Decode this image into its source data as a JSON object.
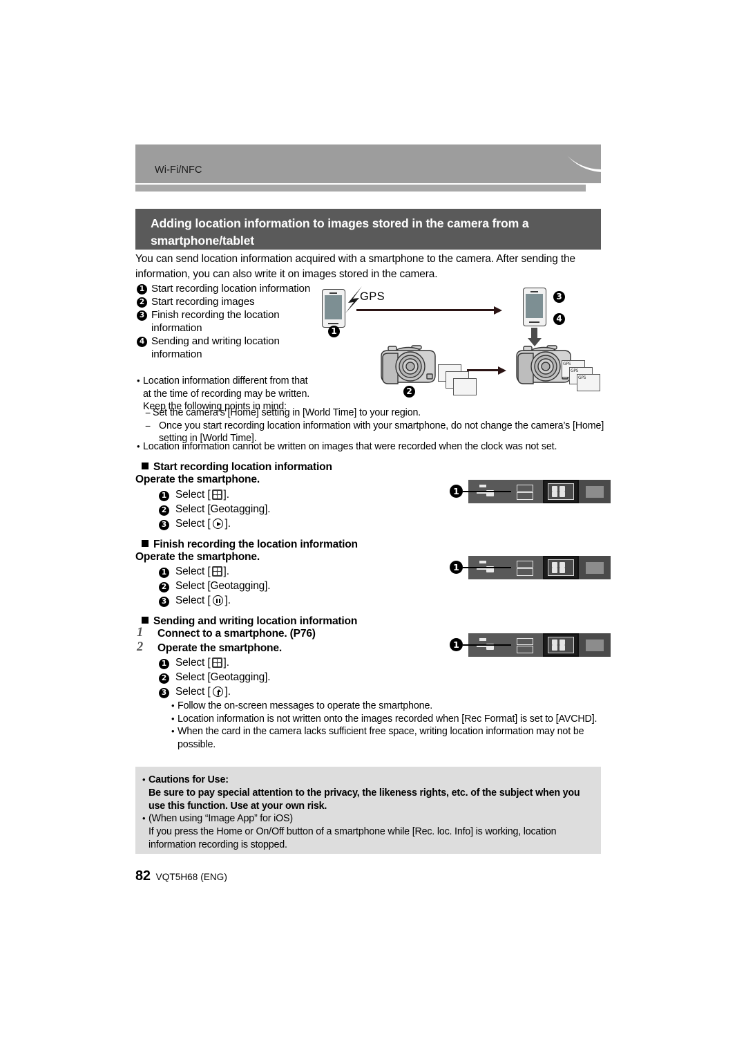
{
  "banner": {
    "label": "Wi-Fi/NFC"
  },
  "section": {
    "title": "Adding location information to images stored in the camera from a smartphone/tablet",
    "intro": "You can send location information acquired with a smartphone to the camera. After sending the information, you can also write it on images stored in the camera."
  },
  "legend": {
    "items": [
      {
        "num": "1",
        "text": "Start recording location information"
      },
      {
        "num": "2",
        "text": "Start recording images"
      },
      {
        "num": "3",
        "text": "Finish recording the location information"
      },
      {
        "num": "4",
        "text": "Sending and writing location information"
      }
    ]
  },
  "illustration": {
    "gps_label": "GPS",
    "phone_left_num": "1",
    "phone_right_num_top": "3",
    "phone_right_num_bottom": "4",
    "camera_left_num": "2",
    "photo_tag": "GPS"
  },
  "notes_top": {
    "bullet1": "Location information different from that at the time of recording may be written. Keep the following points in mind:",
    "dash1": "Set the camera’s [Home] setting in [World Time] to your region.",
    "dash2": "Once you start recording location information with your smartphone, do not change the camera’s [Home] setting in [World Time].",
    "bullet2": "Location information cannot be written on images that were recorded when the clock was not set."
  },
  "sections": [
    {
      "heading": "Start recording location information",
      "operate": "Operate the smartphone.",
      "steps": [
        {
          "num": "1",
          "prefix": "Select [",
          "icon": "grid-icon",
          "suffix": "]."
        },
        {
          "num": "2",
          "prefix": "Select [Geotagging].",
          "icon": "",
          "suffix": ""
        },
        {
          "num": "3",
          "prefix": "Select [",
          "icon": "play-circle-icon",
          "suffix": "]."
        }
      ]
    },
    {
      "heading": "Finish recording the location information",
      "operate": "Operate the smartphone.",
      "steps": [
        {
          "num": "1",
          "prefix": "Select [",
          "icon": "grid-icon",
          "suffix": "]."
        },
        {
          "num": "2",
          "prefix": "Select [Geotagging].",
          "icon": "",
          "suffix": ""
        },
        {
          "num": "3",
          "prefix": "Select [",
          "icon": "pause-circle-icon",
          "suffix": "]."
        }
      ]
    },
    {
      "heading": "Sending and writing location information",
      "numbered": [
        {
          "num": "1",
          "text": "Connect to a smartphone. (P76)"
        },
        {
          "num": "2",
          "text": "Operate the smartphone."
        }
      ],
      "steps": [
        {
          "num": "1",
          "prefix": "Select [",
          "icon": "grid-icon",
          "suffix": "]."
        },
        {
          "num": "2",
          "prefix": "Select [Geotagging].",
          "icon": "",
          "suffix": ""
        },
        {
          "num": "3",
          "prefix": "Select [",
          "icon": "upload-circle-icon",
          "suffix": "]."
        }
      ]
    }
  ],
  "notes_bottom": {
    "bullet1": "Follow the on-screen messages to operate the smartphone.",
    "bullet2": "Location information is not written onto the images recorded when [Rec Format] is set to [AVCHD].",
    "bullet3": "When the card in the camera lacks sufficient free space, writing location information may not be possible."
  },
  "cautions": {
    "title": "Cautions for Use:",
    "body1": "Be sure to pay special attention to the privacy, the likeness rights, etc. of the subject when you use this function. Use at your own risk.",
    "bullet2": "(When using “Image App” for iOS)",
    "body2": "If you press the Home or On/Off button of a smartphone while [Rec. loc. Info] is working, location information recording is stopped."
  },
  "toolbar_callout": {
    "num": "1"
  },
  "footer": {
    "page": "82",
    "code": "VQT5H68 (ENG)"
  },
  "colors": {
    "banner_gray": "#9d9d9d",
    "title_gray": "#5a5a5a",
    "cautions_gray": "#dddddd",
    "toolbar_dark": "#595959"
  }
}
